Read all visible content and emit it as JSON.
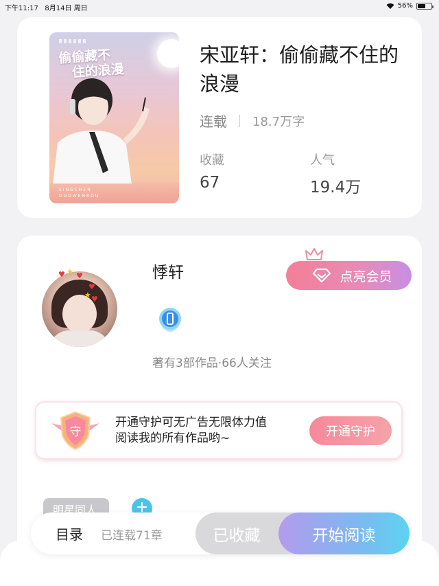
{
  "status_bar": {
    "time": "下午11:17",
    "date": "8月14日 周日",
    "battery": "56%"
  },
  "book": {
    "cover_title_line1": "偷偷藏不",
    "cover_title_line2": "住的浪漫",
    "cover_footer_line1": "SINGCHEN",
    "cover_footer_line2": "DUOWENROU",
    "title": "宋亚轩：偷偷藏不住的浪漫",
    "status": "连载",
    "word_count": "18.7万字",
    "favorites_label": "收藏",
    "favorites_value": "67",
    "popularity_label": "人气",
    "popularity_value": "19.4万"
  },
  "author": {
    "name": "悸轩",
    "vip_button": "点亮会员",
    "meta": "著有3部作品·66人关注",
    "guard_icon_text": "守",
    "guard_line1": "开通守护可无广告无限体力值",
    "guard_line2": "阅读我的所有作品哟~",
    "guard_button": "开通守护",
    "tag": "明星同人",
    "tag_add": "+"
  },
  "bottom_bar": {
    "toc": "目录",
    "chapters": "已连载71章",
    "favorited": "已收藏",
    "start_reading": "开始阅读"
  }
}
